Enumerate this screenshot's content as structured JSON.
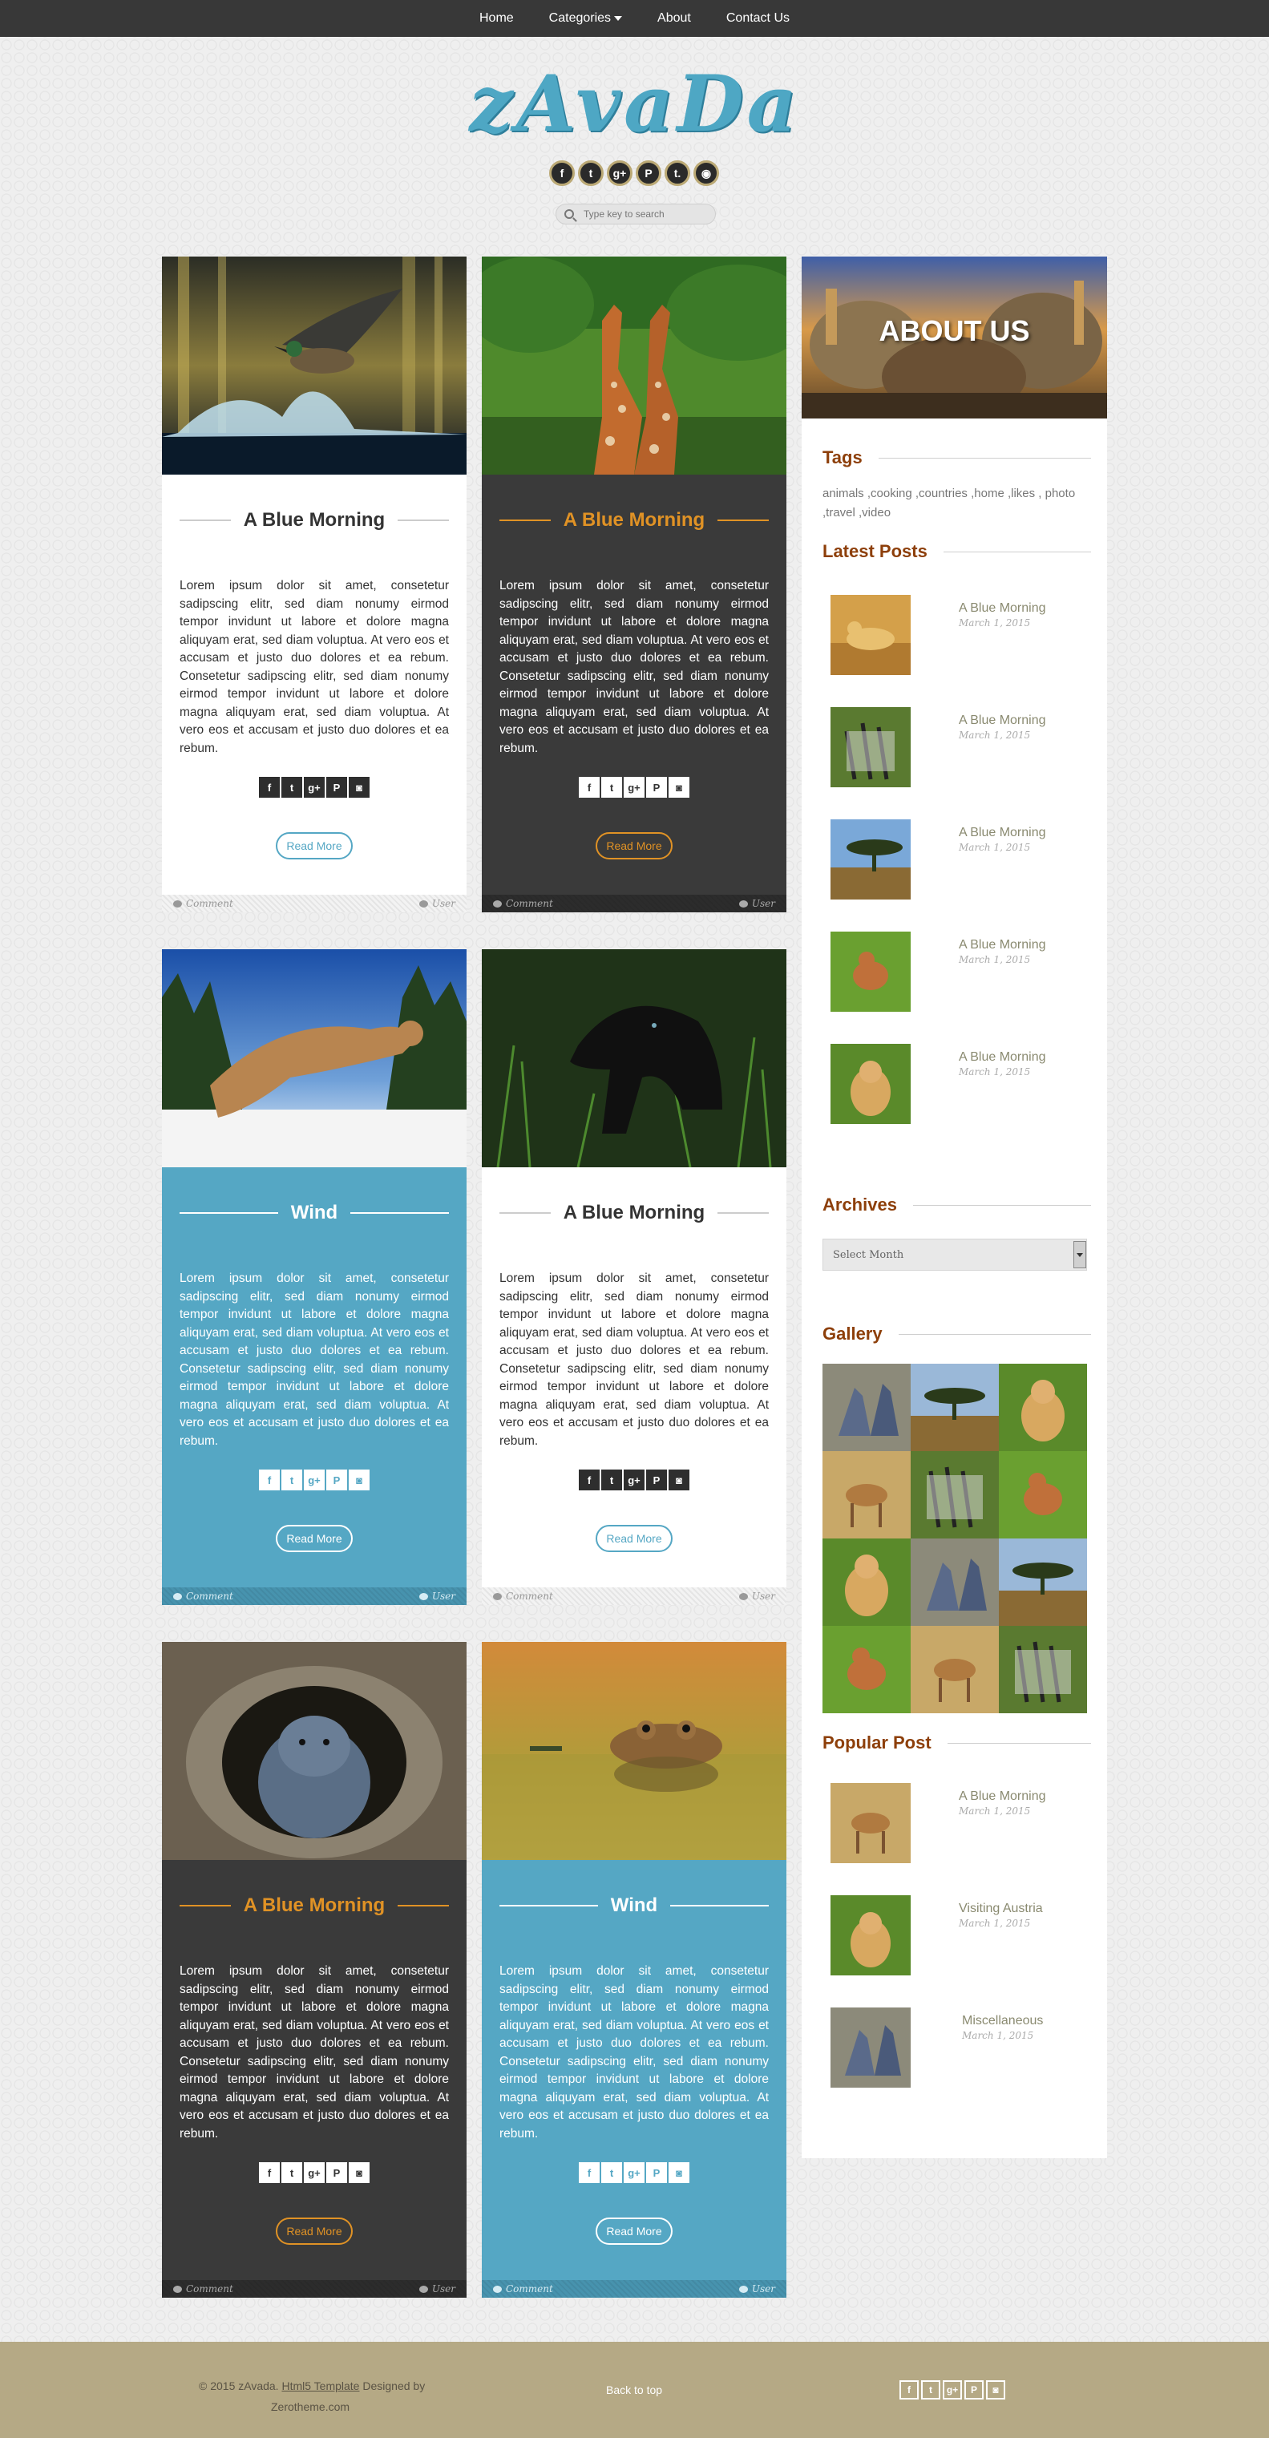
{
  "nav": {
    "items": [
      {
        "label": "Home"
      },
      {
        "label": "Categories"
      },
      {
        "label": "About"
      },
      {
        "label": "Contact Us"
      }
    ]
  },
  "header": {
    "logo": "zAvaDa",
    "social_icons": [
      "facebook-icon",
      "twitter-icon",
      "google-plus-icon",
      "pinterest-icon",
      "tumblr-icon",
      "rss-icon"
    ],
    "search_placeholder": "Type key to search"
  },
  "posts": [
    {
      "title": "A Blue Morning",
      "style": "white",
      "image": "duck-splash",
      "body": "Lorem ipsum dolor sit amet, consetetur sadipscing elitr, sed diam nonumy eirmod tempor invidunt ut labore et dolore magna aliquyam erat, sed diam voluptua. At vero eos et accusam et justo duo dolores et ea rebum. Consetetur sadipscing elitr, sed diam nonumy eirmod tempor invidunt ut labore et dolore magna aliquyam erat, sed diam voluptua. At vero eos et accusam et justo duo dolores et ea rebum.",
      "read_more": "Read More",
      "comment": "Comment",
      "user": "User"
    },
    {
      "title": "A Blue Morning",
      "style": "dark",
      "image": "giraffes",
      "body": "Lorem ipsum dolor sit amet, consetetur sadipscing elitr, sed diam nonumy eirmod tempor invidunt ut labore et dolore magna aliquyam erat, sed diam voluptua. At vero eos et accusam et justo duo dolores et ea rebum. Consetetur sadipscing elitr, sed diam nonumy eirmod tempor invidunt ut labore et dolore magna aliquyam erat, sed diam voluptua. At vero eos et accusam et justo duo dolores et ea rebum.",
      "read_more": "Read More",
      "comment": "Comment",
      "user": "User"
    },
    {
      "title": "Wind",
      "style": "blue",
      "image": "cougar",
      "body": "Lorem ipsum dolor sit amet, consetetur sadipscing elitr, sed diam nonumy eirmod tempor invidunt ut labore et dolore magna aliquyam erat, sed diam voluptua. At vero eos et accusam et justo duo dolores et ea rebum. Consetetur sadipscing elitr, sed diam nonumy eirmod tempor invidunt ut labore et dolore magna aliquyam erat, sed diam voluptua. At vero eos et accusam et justo duo dolores et ea rebum.",
      "read_more": "Read More",
      "comment": "Comment",
      "user": "User"
    },
    {
      "title": "A Blue Morning",
      "style": "white",
      "image": "black-panther",
      "body": "Lorem ipsum dolor sit amet, consetetur sadipscing elitr, sed diam nonumy eirmod tempor invidunt ut labore et dolore magna aliquyam erat, sed diam voluptua. At vero eos et accusam et justo duo dolores et ea rebum. Consetetur sadipscing elitr, sed diam nonumy eirmod tempor invidunt ut labore et dolore magna aliquyam erat, sed diam voluptua. At vero eos et accusam et justo duo dolores et ea rebum.",
      "read_more": "Read More",
      "comment": "Comment",
      "user": "User"
    },
    {
      "title": "A Blue Morning",
      "style": "dark",
      "image": "groundhog",
      "body": "Lorem ipsum dolor sit amet, consetetur sadipscing elitr, sed diam nonumy eirmod tempor invidunt ut labore et dolore magna aliquyam erat, sed diam voluptua. At vero eos et accusam et justo duo dolores et ea rebum. Consetetur sadipscing elitr, sed diam nonumy eirmod tempor invidunt ut labore et dolore magna aliquyam erat, sed diam voluptua. At vero eos et accusam et justo duo dolores et ea rebum.",
      "read_more": "Read More",
      "comment": "Comment",
      "user": "User"
    },
    {
      "title": "Wind",
      "style": "blue",
      "image": "frog",
      "body": "Lorem ipsum dolor sit amet, consetetur sadipscing elitr, sed diam nonumy eirmod tempor invidunt ut labore et dolore magna aliquyam erat, sed diam voluptua. At vero eos et accusam et justo duo dolores et ea rebum. Consetetur sadipscing elitr, sed diam nonumy eirmod tempor invidunt ut labore et dolore magna aliquyam erat, sed diam voluptua. At vero eos et accusam et justo duo dolores et ea rebum.",
      "read_more": "Read More",
      "comment": "Comment",
      "user": "User"
    }
  ],
  "share_icons": [
    "facebook-icon",
    "twitter-icon",
    "google-plus-icon",
    "pinterest-icon",
    "instagram-icon"
  ],
  "sidebar": {
    "about_title": "ABOUT US",
    "tags_heading": "Tags",
    "tags": "animals ,cooking ,countries ,home ,likes , photo ,travel ,video",
    "latest_heading": "Latest Posts",
    "latest_posts": [
      {
        "title": "A Blue Morning",
        "date": "March 1, 2015",
        "image": "cheetah"
      },
      {
        "title": "A Blue Morning",
        "date": "March 1, 2015",
        "image": "zebra"
      },
      {
        "title": "A Blue Morning",
        "date": "March 1, 2015",
        "image": "savanna-tree"
      },
      {
        "title": "A Blue Morning",
        "date": "March 1, 2015",
        "image": "fawn"
      },
      {
        "title": "A Blue Morning",
        "date": "March 1, 2015",
        "image": "monkey"
      }
    ],
    "archives_heading": "Archives",
    "archives_select": "Select Month",
    "gallery_heading": "Gallery",
    "popular_heading": "Popular Post",
    "popular_posts": [
      {
        "title": "A Blue Morning",
        "date": "March 1, 2015",
        "image": "gazelle"
      },
      {
        "title": "Visiting Austria",
        "date": "March 1, 2015",
        "image": "monkey"
      },
      {
        "title": "Miscellaneous",
        "date": "March 1, 2015",
        "image": "cranes"
      }
    ]
  },
  "footer": {
    "copy_prefix": "© 2015 zAvada.",
    "copy_link": "Html5 Template",
    "copy_suffix": "Designed by",
    "copy_site": "Zerotheme.com",
    "back_to_top": "Back to top"
  },
  "colors": {
    "accent_blue": "#55a7c4",
    "accent_orange": "#e09225",
    "heading_brown": "#8d3f0a",
    "nav_bg": "#383838",
    "footer_bg": "#b5a985"
  }
}
